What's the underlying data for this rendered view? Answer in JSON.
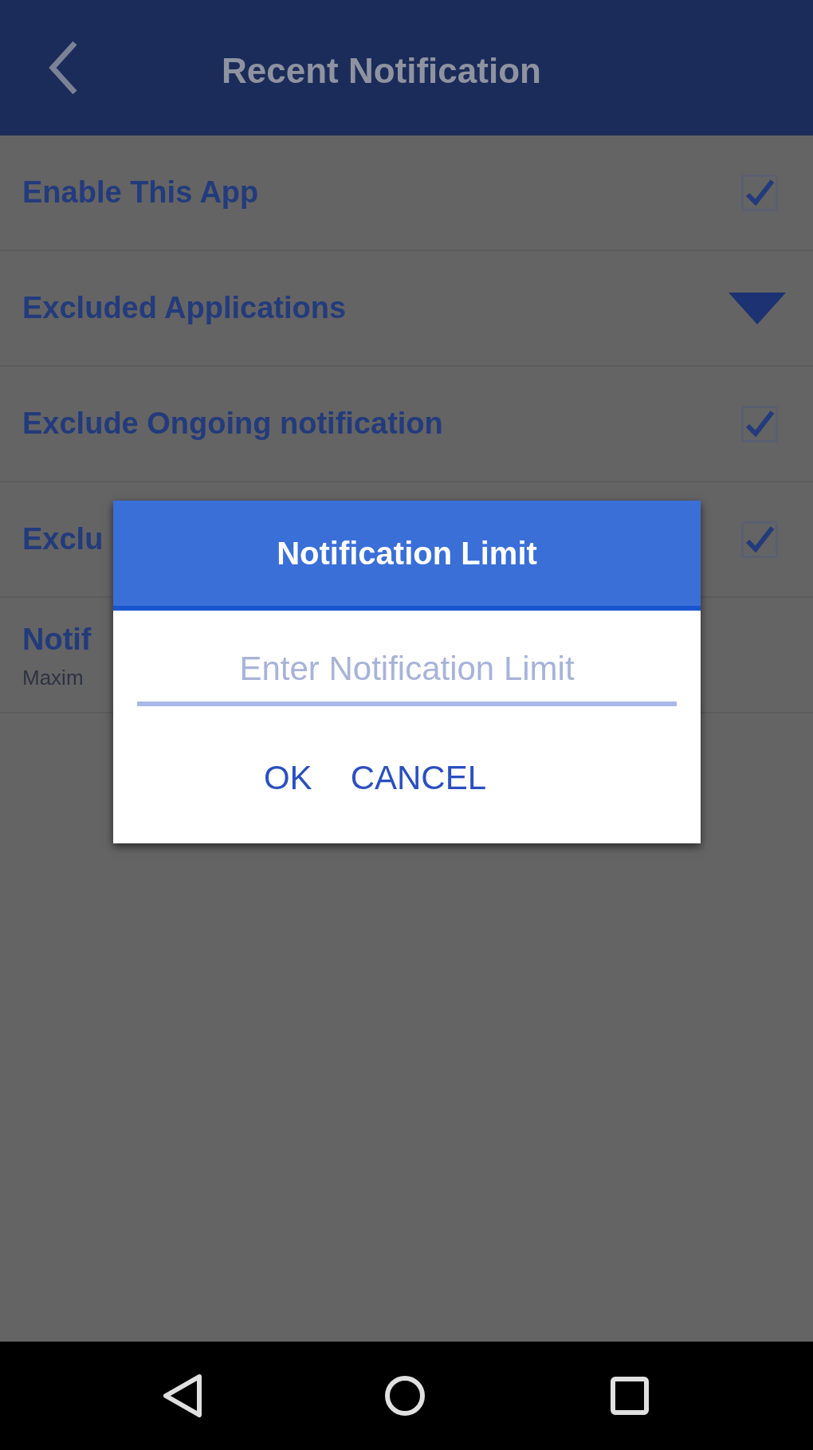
{
  "app_bar": {
    "title": "Recent Notification"
  },
  "settings": [
    {
      "kind": "checkbox",
      "label": "Enable This App",
      "checked": true
    },
    {
      "kind": "dropdown",
      "label": "Excluded Applications"
    },
    {
      "kind": "checkbox",
      "label": "Exclude Ongoing notification",
      "checked": true
    },
    {
      "kind": "checkbox",
      "label": "Exclu",
      "checked": true
    },
    {
      "kind": "text",
      "label": "Notif",
      "summary": "Maxim"
    }
  ],
  "dialog": {
    "title": "Notification Limit",
    "input": {
      "placeholder": "Enter Notification Limit"
    },
    "buttons": [
      "OK",
      "CANCEL"
    ]
  }
}
